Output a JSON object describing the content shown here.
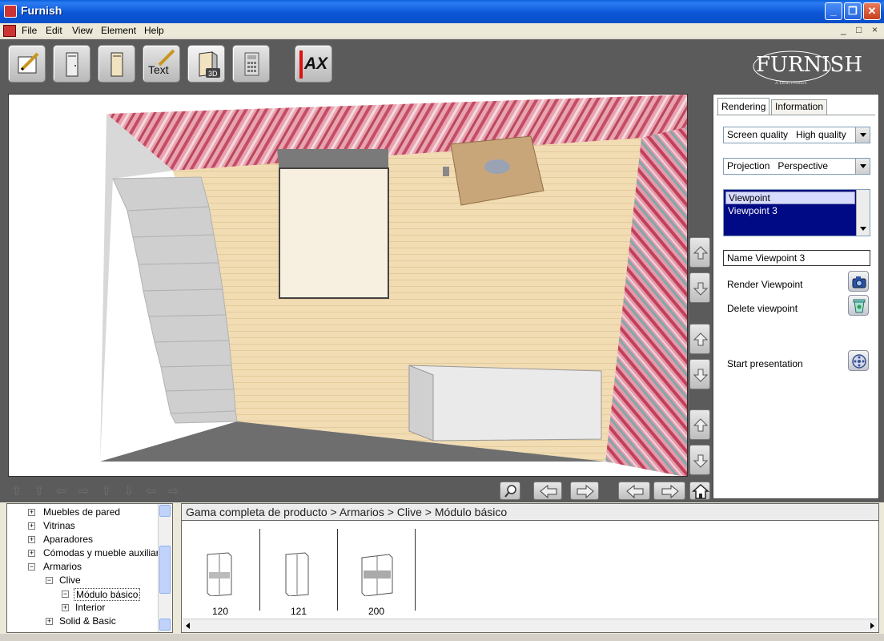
{
  "window": {
    "title": "Furnish"
  },
  "menu": [
    "File",
    "Edit",
    "View",
    "Element",
    "Help"
  ],
  "mdi_controls": [
    "_",
    "□",
    "×"
  ],
  "toolbar": {
    "text_button": "Text",
    "ax_label": "AX"
  },
  "logo": {
    "text": "FURNISH",
    "subtitle": "A Ekon Product"
  },
  "panel": {
    "tabs": [
      "Rendering",
      "Information"
    ],
    "screen_quality": "Screen quality   High quality",
    "projection": "Projection   Perspective",
    "viewpoint_header": "Viewpoint",
    "viewpoint_selected": "Viewpoint 3",
    "name_field": "Name Viewpoint 3",
    "render_viewpoint": "Render Viewpoint",
    "delete_viewpoint": "Delete viewpoint",
    "start_presentation": "Start presentation"
  },
  "tree": [
    "Muebles de pared",
    "Vitrinas",
    "Aparadores",
    "Cómodas y mueble auxiliar",
    "Armarios",
    "Clive",
    "Módulo básico",
    "Interior",
    "Solid & Basic"
  ],
  "breadcrumb": "Gama completa de producto > Armarios > Clive > Módulo básico",
  "catalog": [
    "120",
    "121",
    "200"
  ],
  "colors": {
    "title_bar": "#0b56d6",
    "workspace": "#5b5b5b",
    "selection": "#000a84",
    "wall_pink": "#d97a8e"
  }
}
